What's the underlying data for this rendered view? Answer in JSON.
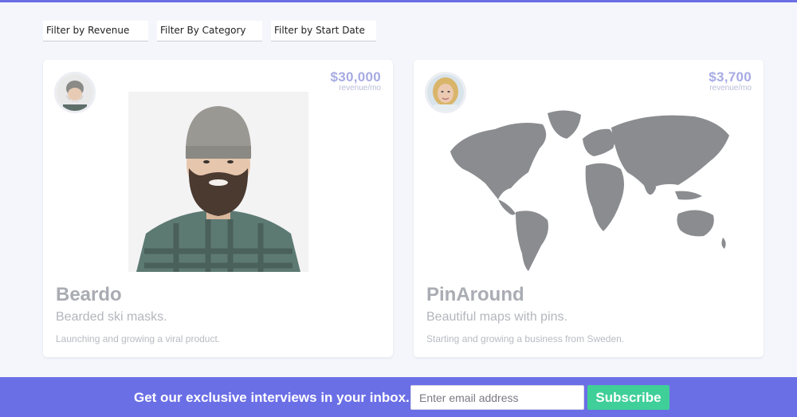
{
  "filters": [
    {
      "label": "Filter by Revenue"
    },
    {
      "label": "Filter By Category"
    },
    {
      "label": "Filter by Start Date"
    }
  ],
  "cards": [
    {
      "revenue": "$30,000",
      "revenue_unit": "revenue/mo",
      "name": "Beardo",
      "tagline": "Bearded ski masks.",
      "description": "Launching and growing a viral product."
    },
    {
      "revenue": "$3,700",
      "revenue_unit": "revenue/mo",
      "name": "PinAround",
      "tagline": "Beautiful maps with pins.",
      "description": "Starting and growing a business from Sweden."
    }
  ],
  "newsletter": {
    "prompt": "Get our exclusive interviews in your inbox.",
    "email_placeholder": "Enter email address",
    "button_label": "Subscribe"
  },
  "colors": {
    "accent": "#6b6fe6",
    "button": "#3fcf98",
    "revenue": "#a7abe3"
  }
}
